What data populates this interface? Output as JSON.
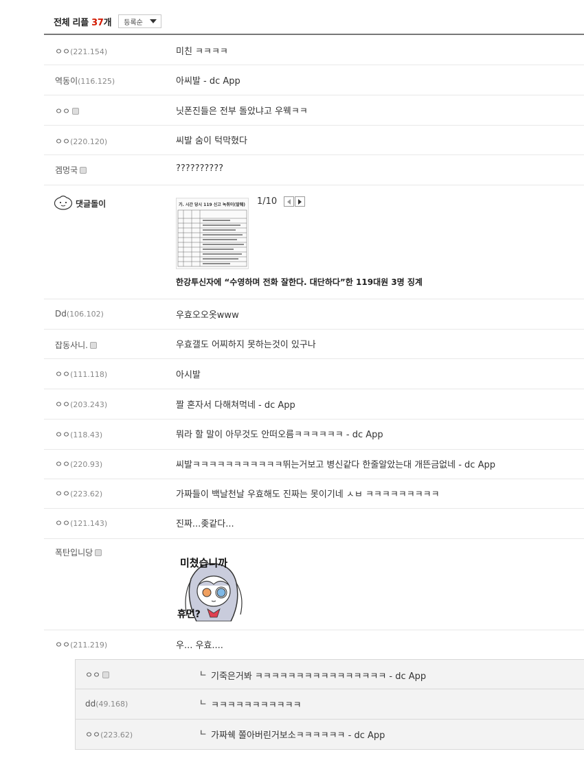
{
  "header": {
    "title": "전체 리플",
    "count": "37",
    "count_suffix": "개",
    "sort_label": "등록순"
  },
  "comments": [
    {
      "nick": "ㅇㅇ",
      "ip": "(221.154)",
      "text": "미친 ㅋㅋㅋㅋ"
    },
    {
      "nick": "역동이",
      "ip": "(116.125)",
      "text": "아씨발 - dc App"
    },
    {
      "nick": "ㅇㅇ",
      "ip": "",
      "gallog": true,
      "text": "닛폰진들은 전부 돌았냐고 우웩ㅋㅋ"
    },
    {
      "nick": "ㅇㅇ",
      "ip": "(220.120)",
      "text": "씨발 숨이 턱막혔다"
    },
    {
      "nick": "겜멍국",
      "ip": "",
      "gallog": true,
      "text": "??????????"
    }
  ],
  "dory": {
    "name": "댓글돌이",
    "page": "1/10",
    "thumb_caption": "가. 시간 당시 119 신고 녹취이(발췌)",
    "title": "한강투신자에 “수영하며 전화 잘한다. 대단하다”한 119대원 3명 징계"
  },
  "comments2": [
    {
      "nick": "Dd",
      "ip": "(106.102)",
      "text": "우효오오옷www"
    },
    {
      "nick": "잡동사니.",
      "ip": "",
      "gallog": true,
      "text": "우효갤도 어찌하지 못하는것이 있구나"
    },
    {
      "nick": "ㅇㅇ",
      "ip": "(111.118)",
      "text": "아시발"
    },
    {
      "nick": "ㅇㅇ",
      "ip": "(203.243)",
      "text": "짤 혼자서 다해쳐먹네 - dc App"
    },
    {
      "nick": "ㅇㅇ",
      "ip": "(118.43)",
      "text": "뭐라 할 말이 아무것도 안떠오름ㅋㅋㅋㅋㅋㅋ - dc App"
    },
    {
      "nick": "ㅇㅇ",
      "ip": "(220.93)",
      "text": "씨발ㅋㅋㅋㅋㅋㅋㅋㅋㅋㅋㅋ뛰는거보고 병신같다 한줄알았는대 개뜬금없네 - dc App"
    },
    {
      "nick": "ㅇㅇ",
      "ip": "(223.62)",
      "text": "가짜들이 백날천날 우효해도 진짜는 못이기네 ㅅㅂ ㅋㅋㅋㅋㅋㅋㅋㅋㅋ"
    },
    {
      "nick": "ㅇㅇ",
      "ip": "(121.143)",
      "text": "진짜...좆같다..."
    }
  ],
  "sticker_comment": {
    "nick": "폭탄입니당",
    "gallog": true,
    "sticker_text_top": "미쳤습니까",
    "sticker_text_bottom": "휴먼?"
  },
  "last_comment": {
    "nick": "ㅇㅇ",
    "ip": "(211.219)",
    "text": "우... 우효...."
  },
  "replies": [
    {
      "nick": "ㅇㅇ",
      "ip": "",
      "gallog": true,
      "text": "기죽은거봐 ㅋㅋㅋㅋㅋㅋㅋㅋㅋㅋㅋㅋㅋㅋㅋㅋ - dc App"
    },
    {
      "nick": "dd",
      "ip": "(49.168)",
      "text": "ㅋㅋㅋㅋㅋㅋㅋㅋㅋㅋㅋ"
    },
    {
      "nick": "ㅇㅇ",
      "ip": "(223.62)",
      "text": "가짜쉑 쫄아버린거보소ㅋㅋㅋㅋㅋㅋ - dc App"
    }
  ],
  "reply_arrow": "ㄴ"
}
